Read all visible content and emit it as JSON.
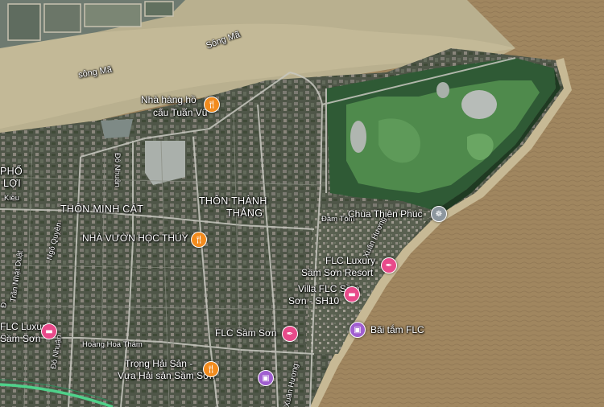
{
  "map": {
    "water_labels": [
      "Sông Mã",
      "sông Mã"
    ],
    "area_labels": [
      {
        "id": "pho-loi-1",
        "text": "PHỐ"
      },
      {
        "id": "pho-loi-2",
        "text": "LỢI"
      },
      {
        "id": "minh-cat",
        "text": "THÔN MINH CÁT"
      },
      {
        "id": "thanh-thang-1",
        "text": "THÔN THÀNH"
      },
      {
        "id": "thanh-thang-2",
        "text": "THẮNG"
      }
    ],
    "road_labels": [
      "Đô Nhuận",
      "Đô Nhuận",
      "Ngô Quyền",
      "Trần Nhật Duật",
      "Hoàng Hoa Thám",
      "Xuân Hương",
      "Xuân Hương",
      "Đầm Tôm",
      "Kiều",
      "Đ"
    ],
    "pois": [
      {
        "id": "nha-hang-1",
        "text": "Nhà hàng hồ",
        "type": "restaurant",
        "icon": "fork-knife-icon",
        "color": "#f28b1e"
      },
      {
        "id": "nha-hang-2",
        "text": "câu Tuấn Vũ",
        "type": "restaurant"
      },
      {
        "id": "nha-vuon",
        "text": "NHÀ VƯỜN HỌC THÚY",
        "type": "restaurant",
        "icon": "fork-knife-icon",
        "color": "#f28b1e"
      },
      {
        "id": "chua",
        "text": "Chùa Thiên Phúc",
        "type": "temple",
        "icon": "buddhist-temple-icon",
        "color": "#8c969e"
      },
      {
        "id": "flc-resort-1",
        "text": "FLC Luxury",
        "type": "resort",
        "icon": "resort-icon",
        "color": "#e84a8a"
      },
      {
        "id": "flc-resort-2",
        "text": "Sầm Sơn Resort",
        "type": "resort"
      },
      {
        "id": "villa-1",
        "text": "Villa FLC Sầm",
        "type": "hotel",
        "icon": "bed-icon",
        "color": "#e84a8a"
      },
      {
        "id": "villa-2",
        "text": "Sơn - SH10",
        "type": "hotel"
      },
      {
        "id": "flc-lux-1",
        "text": "FLC Luxury",
        "type": "hotel",
        "icon": "bed-icon",
        "color": "#e84a8a"
      },
      {
        "id": "flc-lux-2",
        "text": "Sầm Sơn",
        "type": "hotel"
      },
      {
        "id": "flc-samson",
        "text": "FLC Sầm Sơn",
        "type": "resort",
        "icon": "resort-icon",
        "color": "#e84a8a"
      },
      {
        "id": "bai-tam",
        "text": "Bãi tắm FLC",
        "type": "beach",
        "icon": "beach-camera-icon",
        "color": "#a05ed0"
      },
      {
        "id": "trong-hai-san-1",
        "text": "Trọng Hải Sản -",
        "type": "restaurant",
        "icon": "fork-knife-icon",
        "color": "#f28b1e"
      },
      {
        "id": "trong-hai-san-2",
        "text": "Vựa Hải sản Sầm Sơn",
        "type": "restaurant"
      }
    ]
  }
}
